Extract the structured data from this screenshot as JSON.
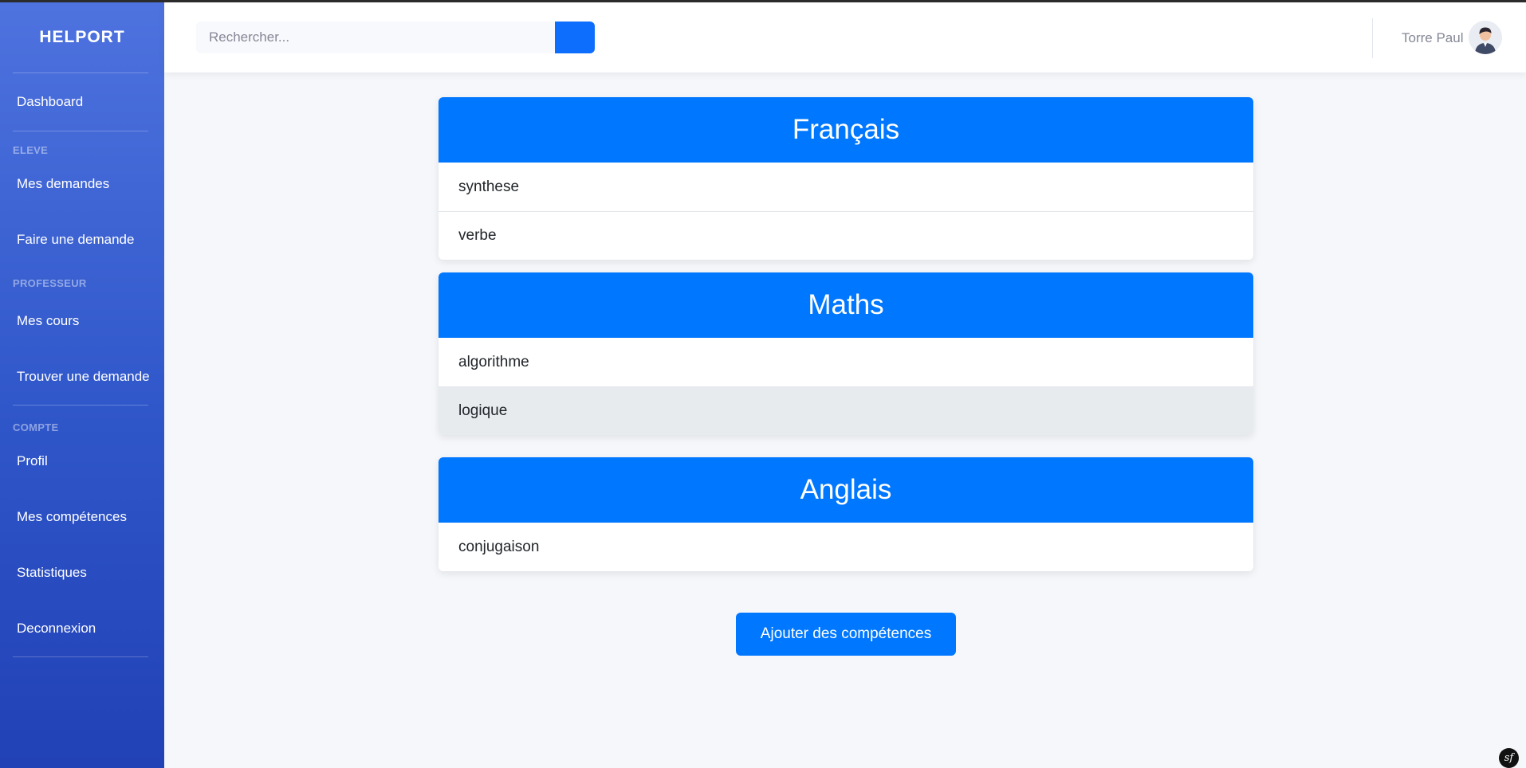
{
  "sidebar": {
    "brand": "HELPORT",
    "dashboard": "Dashboard",
    "sections": [
      {
        "heading": "ELEVE",
        "items": [
          "Mes demandes",
          "Faire une demande"
        ]
      },
      {
        "heading": "PROFESSEUR",
        "items": [
          "Mes cours",
          "Trouver une demande"
        ]
      },
      {
        "heading": "COMPTE",
        "items": [
          "Profil",
          "Mes compétences",
          "Statistiques",
          "Deconnexion"
        ]
      }
    ]
  },
  "topbar": {
    "search_placeholder": "Rechercher...",
    "user_name": "Torre Paul",
    "avatar_icon": "user-avatar-icon"
  },
  "subjects": [
    {
      "name": "Français",
      "skills": [
        "synthese",
        "verbe"
      ]
    },
    {
      "name": "Maths",
      "skills": [
        "algorithme",
        "logique"
      ]
    },
    {
      "name": "Anglais",
      "skills": [
        "conjugaison"
      ]
    }
  ],
  "add_button_label": "Ajouter des compétences",
  "symfony_badge": "sf",
  "colors": {
    "primary": "#0077ff",
    "sidebar": "#4e73df"
  }
}
